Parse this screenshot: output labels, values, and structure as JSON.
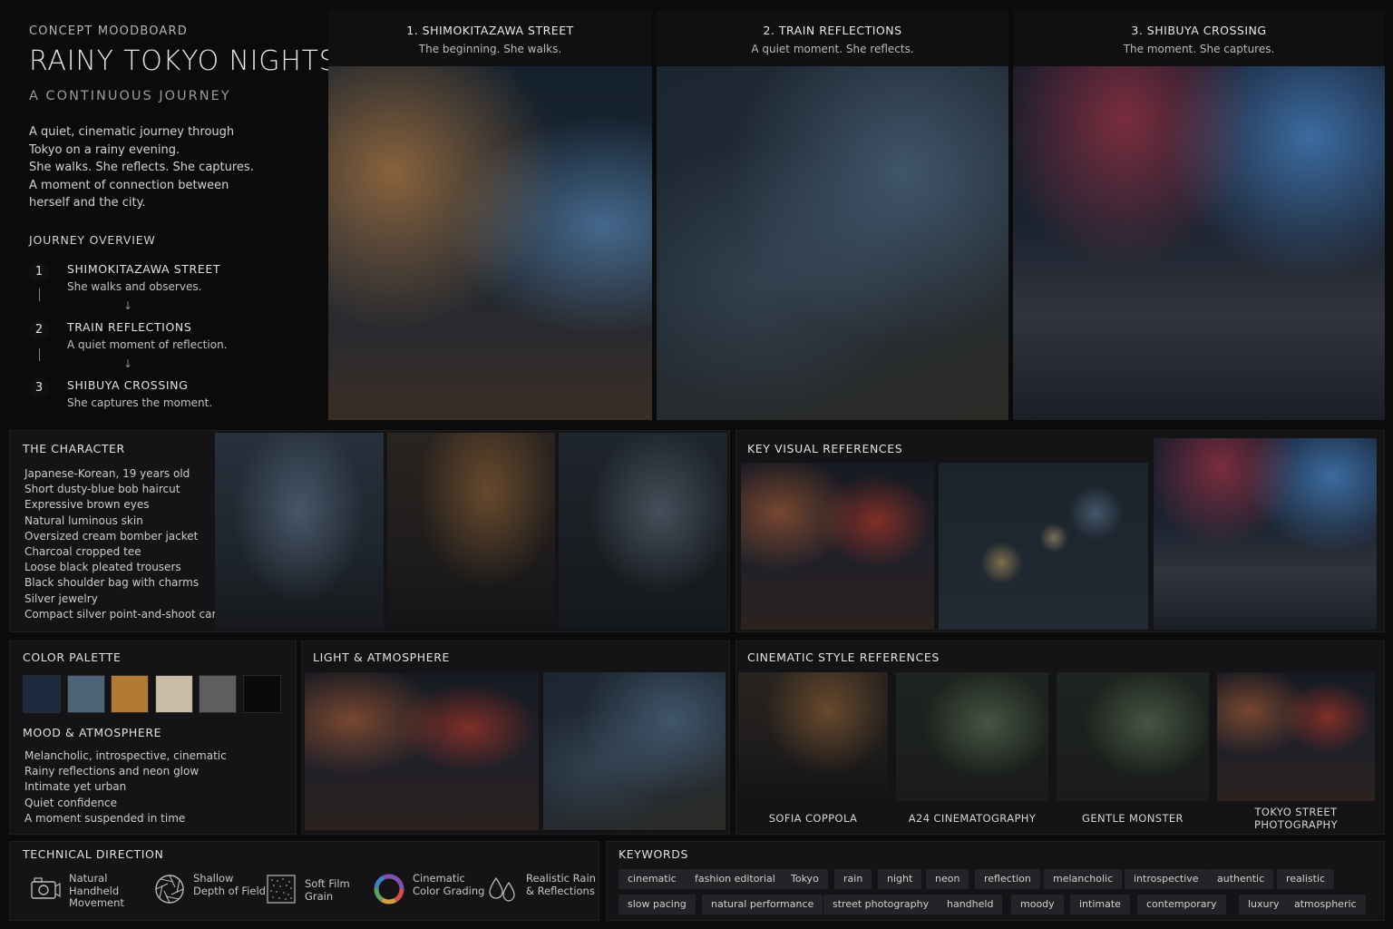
{
  "header": {
    "kicker": "CONCEPT MOODBOARD",
    "title": "RAINY TOKYO NIGHTS",
    "subtitle": "A CONTINUOUS JOURNEY",
    "intro": [
      "A quiet, cinematic journey through",
      "Tokyo on a rainy evening.",
      "She walks. She reflects. She captures.",
      "A moment of connection between",
      "herself and the city."
    ]
  },
  "journey": {
    "title": "JOURNEY OVERVIEW",
    "steps": [
      {
        "num": "1",
        "title": "SHIMOKITAZAWA STREET",
        "desc": "She walks and observes."
      },
      {
        "num": "2",
        "title": "TRAIN REFLECTIONS",
        "desc": "A quiet moment of reflection."
      },
      {
        "num": "3",
        "title": "SHIBUYA CROSSING",
        "desc": "She captures the moment."
      }
    ]
  },
  "hero": [
    {
      "title": "1. SHIMOKITAZAWA STREET",
      "sub": "The beginning. She walks."
    },
    {
      "title": "2. TRAIN REFLECTIONS",
      "sub": "A quiet moment. She reflects."
    },
    {
      "title": "3. SHIBUYA CROSSING",
      "sub": "The moment. She captures."
    }
  ],
  "character": {
    "title": "THE CHARACTER",
    "traits": [
      "Japanese-Korean, 19 years old",
      "Short dusty-blue bob haircut",
      "Expressive brown eyes",
      "Natural luminous skin",
      "Oversized cream bomber jacket",
      "Charcoal cropped tee",
      "Loose black pleated trousers",
      "Black shoulder bag with charms",
      "Silver jewelry",
      "Compact silver point-and-shoot camera"
    ]
  },
  "key_visuals": {
    "title": "KEY VISUAL REFERENCES"
  },
  "palette": {
    "title": "COLOR PALETTE",
    "colors": [
      "#1b2a3d",
      "#4d6478",
      "#b27a34",
      "#c9bca6",
      "#5e5e5e",
      "#0a0a0a"
    ]
  },
  "mood": {
    "title": "MOOD & ATMOSPHERE",
    "items": [
      "Melancholic, introspective, cinematic",
      "Rainy reflections and neon glow",
      "Intimate yet urban",
      "Quiet confidence",
      "A moment suspended in time"
    ]
  },
  "light": {
    "title": "LIGHT & ATMOSPHERE"
  },
  "cinematic": {
    "title": "CINEMATIC STYLE REFERENCES",
    "refs": [
      "SOFIA COPPOLA",
      "A24 CINEMATOGRAPHY",
      "GENTLE MONSTER",
      "TOKYO STREET PHOTOGRAPHY"
    ]
  },
  "technical": {
    "title": "TECHNICAL DIRECTION",
    "items": [
      {
        "label": "Natural Handheld Movement",
        "icon": "camera-icon"
      },
      {
        "label": "Shallow Depth of Field",
        "icon": "aperture-icon"
      },
      {
        "label": "Soft Film Grain",
        "icon": "grain-icon"
      },
      {
        "label": "Cinematic Color Grading",
        "icon": "color-wheel-icon"
      },
      {
        "label": "Realistic Rain & Reflections",
        "icon": "raindrops-icon"
      }
    ]
  },
  "keywords": {
    "title": "KEYWORDS",
    "row1": [
      "cinematic",
      "fashion editorial",
      "Tokyo",
      "rain",
      "night",
      "neon",
      "reflection",
      "melancholic",
      "introspective",
      "authentic",
      "realistic"
    ],
    "row2": [
      "slow pacing",
      "natural performance",
      "street photography",
      "handheld",
      "moody",
      "intimate",
      "contemporary",
      "luxury",
      "atmospheric"
    ]
  }
}
